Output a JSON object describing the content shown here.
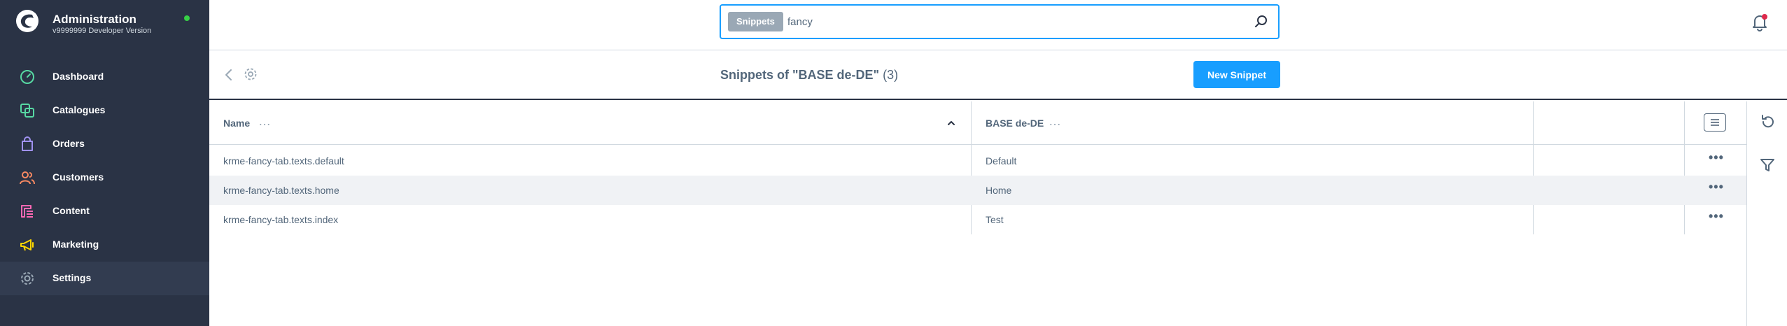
{
  "brand": {
    "title": "Administration",
    "version": "v9999999 Developer Version"
  },
  "nav": [
    {
      "label": "Dashboard",
      "icon": "dashboard-icon",
      "color": "#57d9a3"
    },
    {
      "label": "Catalogues",
      "icon": "catalogues-icon",
      "color": "#57d9a3"
    },
    {
      "label": "Orders",
      "icon": "orders-icon",
      "color": "#a092f0"
    },
    {
      "label": "Customers",
      "icon": "customers-icon",
      "color": "#f88962"
    },
    {
      "label": "Content",
      "icon": "content-icon",
      "color": "#ff68b4"
    },
    {
      "label": "Marketing",
      "icon": "marketing-icon",
      "color": "#ffd700"
    },
    {
      "label": "Settings",
      "icon": "settings-icon",
      "color": "#9aa8b5",
      "active": true
    }
  ],
  "search": {
    "type_label": "Snippets",
    "value": "fancy"
  },
  "smartbar": {
    "title": "Snippets of \"BASE de-DE\"",
    "count": "(3)",
    "new_button": "New Snippet"
  },
  "grid": {
    "columns": [
      "Name",
      "BASE de-DE"
    ],
    "rows": [
      {
        "name": "krme-fancy-tab.texts.default",
        "value": "Default"
      },
      {
        "name": "krme-fancy-tab.texts.home",
        "value": "Home"
      },
      {
        "name": "krme-fancy-tab.texts.index",
        "value": "Test"
      }
    ],
    "more_label": "…",
    "row_actions_label": "•••"
  },
  "colors": {
    "sidebar_bg": "#2a3345",
    "accent": "#189eff",
    "text": "#52667a",
    "status_online": "#37d046",
    "notification": "#de294c"
  }
}
